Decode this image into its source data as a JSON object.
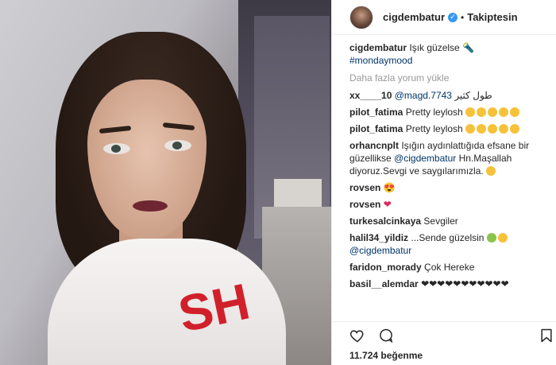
{
  "header": {
    "username": "cigdembatur",
    "verified_mark": "✓",
    "separator": "•",
    "follow_label": "Takiptesin"
  },
  "photo": {
    "shirt_text": "SH"
  },
  "caption": {
    "user": "cigdembatur",
    "text": "Işık güzelse",
    "emoji": "🔦",
    "hashtag": "#mondaymood"
  },
  "load_more": "Daha fazla yorum yükle",
  "comments": [
    {
      "user": "xx____10",
      "mention": "@magd.7743",
      "text": " طول كثير"
    },
    {
      "user": "pilot_fatima",
      "text": "Pretty leylosh",
      "emojis": 5
    },
    {
      "user": "pilot_fatima",
      "text": "Pretty leylosh",
      "emojis": 5
    },
    {
      "user": "orhancnplt",
      "text": "Işığın aydınlattığıda efsane bir güzellikse",
      "mention": "@cigdembatur",
      "text2": "Hn.Maşallah diyoruz.Sevgi ve saygılarımızla."
    },
    {
      "user": "rovsen",
      "emoji": "😍"
    },
    {
      "user": "rovsen",
      "emoji": "❤"
    },
    {
      "user": "turkesalcinkaya",
      "text": "Sevgiler"
    },
    {
      "user": "halil34_yildiz",
      "text": "...Sende güzelsin",
      "mention": "@cigdembatur"
    },
    {
      "user": "faridon_morady",
      "text": "Çok Hereke"
    },
    {
      "user": "basil__alemdar",
      "text": "❤❤❤❤❤❤❤❤❤❤❤"
    }
  ],
  "actions": {
    "like_icon": "heart-outline",
    "comment_icon": "comment-bubble",
    "save_icon": "bookmark"
  },
  "likes_text": "11.724 beğenme",
  "colors": {
    "link": "#003569",
    "verified": "#3897f0",
    "muted": "#999999",
    "heart": "#e0245e"
  }
}
